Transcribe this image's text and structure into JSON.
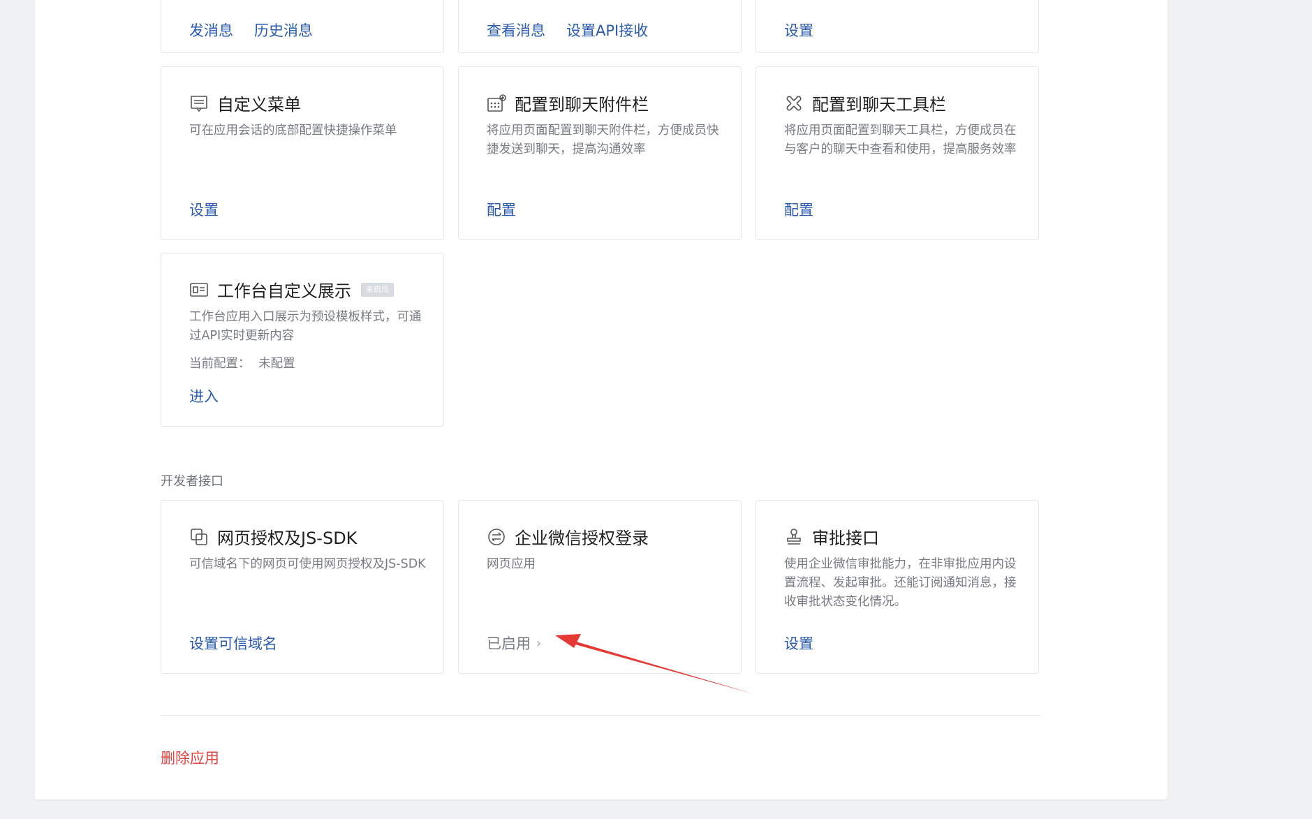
{
  "cards_top": [
    {
      "actions": [
        "发消息",
        "历史消息"
      ]
    },
    {
      "actions": [
        "查看消息",
        "设置API接收"
      ]
    },
    {
      "actions": [
        "设置"
      ]
    }
  ],
  "cards_mid": [
    {
      "icon": "menu-icon",
      "title": "自定义菜单",
      "desc": "可在应用会话的底部配置快捷操作菜单",
      "action": "设置"
    },
    {
      "icon": "attachment-bar-icon",
      "title": "配置到聊天附件栏",
      "desc": "将应用页面配置到聊天附件栏，方便成员快捷发送到聊天，提高沟通效率",
      "action": "配置"
    },
    {
      "icon": "toolbar-icon",
      "title": "配置到聊天工具栏",
      "desc": "将应用页面配置到聊天工具栏，方便成员在与客户的聊天中查看和使用，提高服务效率",
      "action": "配置"
    }
  ],
  "workbench": {
    "icon": "workbench-card-icon",
    "title": "工作台自定义展示",
    "badge": "未启用",
    "desc": "工作台应用入口展示为预设模板样式，可通过API实时更新内容",
    "config_label": "当前配置：",
    "config_value": "未配置",
    "action": "进入"
  },
  "developer_section": {
    "label": "开发者接口",
    "cards": [
      {
        "icon": "web-auth-icon",
        "title": "网页授权及JS-SDK",
        "desc": "可信域名下的网页可使用网页授权及JS-SDK",
        "action": "设置可信域名"
      },
      {
        "icon": "wecom-login-icon",
        "title": "企业微信授权登录",
        "desc": "网页应用",
        "status": "已启用"
      },
      {
        "icon": "approval-stamp-icon",
        "title": "审批接口",
        "desc": "使用企业微信审批能力，在非审批应用内设置流程、发起审批。还能订阅通知消息，接收审批状态变化情况。",
        "action": "设置"
      }
    ]
  },
  "delete_label": "删除应用",
  "colors": {
    "link": "#2a5bb0",
    "danger": "#e64340",
    "annotation_arrow": "#e53935"
  }
}
